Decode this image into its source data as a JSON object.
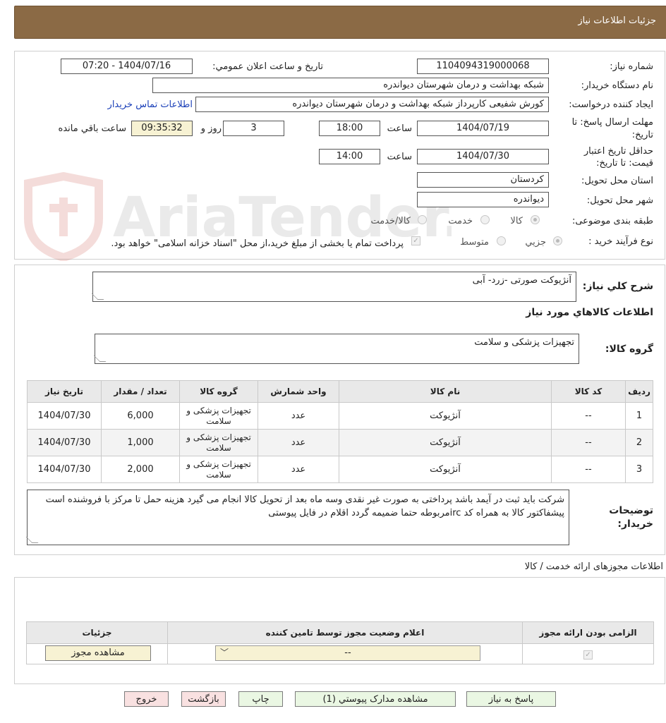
{
  "header": {
    "title": "جزئیات اطلاعات نیاز"
  },
  "form": {
    "need_number": {
      "label": "شماره نیاز:",
      "value": "1104094319000068"
    },
    "announce_datetime": {
      "label": "تاریخ و ساعت اعلان عمومي:",
      "value": "1404/07/16 - 07:20"
    },
    "buyer_org": {
      "label": "نام دستگاه خریدار:",
      "value": "شبکه بهداشت و درمان شهرستان دیواندره"
    },
    "requester": {
      "label": "ایجاد کننده درخواست:",
      "value": "کورش شفیعی کارپرداز شبکه بهداشت و درمان شهرستان دیواندره",
      "contact_link": "اطلاعات تماس خریدار"
    },
    "reply_deadline": {
      "label_line1": "مهلت ارسال پاسخ: تا",
      "label_line2": "تاریخ:",
      "date": "1404/07/19",
      "time_label": "ساعت",
      "time": "18:00",
      "days": "3",
      "days_label": "روز و",
      "remaining": "09:35:32",
      "remaining_label": "ساعت باقي مانده"
    },
    "price_validity": {
      "label_line1": "حداقل تاریخ اعتبار",
      "label_line2": "قیمت: تا تاریخ:",
      "date": "1404/07/30",
      "time_label": "ساعت",
      "time": "14:00"
    },
    "province": {
      "label": "استان محل تحویل:",
      "value": "کردستان"
    },
    "city": {
      "label": "شهر محل تحویل:",
      "value": "دیواندره"
    },
    "category": {
      "label": "طبقه بندی موضوعی:",
      "options": [
        "کالا",
        "خدمت",
        "کالا/خدمت"
      ],
      "selected": "کالا"
    },
    "process_type": {
      "label": "نوع فرآیند خرید :",
      "options": [
        "جزیي",
        "متوسط"
      ],
      "selected": "جزیي",
      "note": "پرداخت تمام یا بخشی از مبلغ خرید،از محل \"اسناد خزانه اسلامی\" خواهد بود."
    }
  },
  "summary": {
    "label": "شرح کلي نياز:",
    "value": "آنژیوکت صورتی -زرد- آبی",
    "goods_info_title": "اطلاعات کالاهاي مورد نياز",
    "group_label": "گروه کالا:",
    "group_value": "تجهیزات پزشکی و سلامت"
  },
  "items_table": {
    "headers": [
      "ردیف",
      "کد کالا",
      "نام کالا",
      "واحد شمارش",
      "گروه کالا",
      "تعداد / مقدار",
      "تاریخ نیاز"
    ],
    "rows": [
      [
        "1",
        "--",
        "آنژیوکت",
        "عدد",
        "تجهیزات پزشکی و سلامت",
        "6,000",
        "1404/07/30"
      ],
      [
        "2",
        "--",
        "آنژیوکت",
        "عدد",
        "تجهیزات پزشکی و سلامت",
        "1,000",
        "1404/07/30"
      ],
      [
        "3",
        "--",
        "آنژیوکت",
        "عدد",
        "تجهیزات پزشکی و سلامت",
        "2,000",
        "1404/07/30"
      ]
    ]
  },
  "buyer_notes": {
    "label_line1": "توضیحات",
    "label_line2": "خریدار:",
    "value": "شرکت باید ثبت در آیمد باشد پرداختی به صورت غیر نقدی وسه ماه بعد از تحویل کالا انجام می گیرد هزینه حمل تا مرکز با فروشنده است پیشفاکتور کالا به همراه کد ircمربوطه حتما ضمیمه گردد اقلام در فایل پیوستی"
  },
  "permits": {
    "title": "اطلاعات مجوزهای ارائه خدمت / کالا",
    "headers": [
      "الزامی بودن ارائه مجوز",
      "اعلام وضعیت مجوز توسط تامین کننده",
      "جزئیات"
    ],
    "select_value": "--",
    "view_button": "مشاهده مجوز"
  },
  "actions": {
    "reply": "پاسخ به نیاز",
    "attachments": "مشاهده مدارک پیوستي (1)",
    "print": "چاپ",
    "back": "بازگشت",
    "exit": "خروج"
  },
  "watermark": {
    "text": "AriaTender.neT"
  },
  "colors": {
    "header": "#8b6a45",
    "link": "#1a3fb8",
    "button_green": "#eaf7e3",
    "button_pink": "#f9e1e1",
    "button_yellow": "#f7f2d3"
  }
}
